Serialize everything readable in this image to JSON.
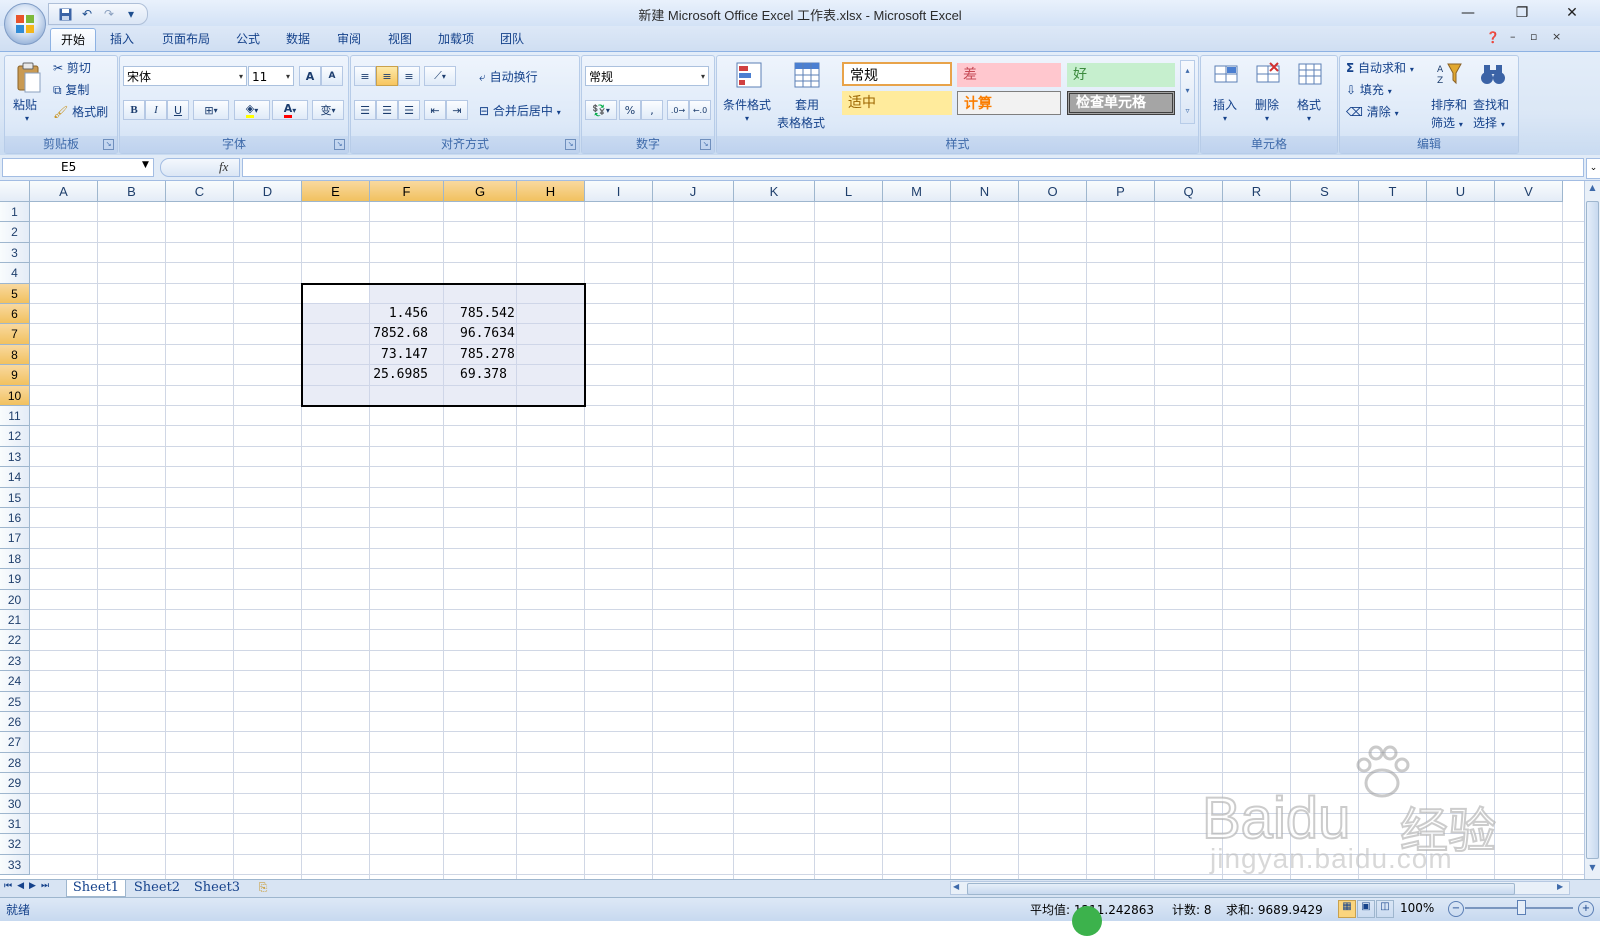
{
  "window": {
    "title": "新建 Microsoft Office Excel 工作表.xlsx - Microsoft Excel",
    "minimize": "—",
    "restore": "❐",
    "close": "✕"
  },
  "qat": {
    "save": "save-icon",
    "undo": "↶",
    "redo": "↷",
    "more": "▾"
  },
  "tabs": [
    "开始",
    "插入",
    "页面布局",
    "公式",
    "数据",
    "审阅",
    "视图",
    "加载项",
    "团队"
  ],
  "ribbon": {
    "clipboard": {
      "label": "剪贴板",
      "paste": "粘贴",
      "cut": "剪切",
      "copy": "复制",
      "format_painter": "格式刷"
    },
    "font": {
      "label": "字体",
      "name": "宋体",
      "size": "11",
      "bold": "B",
      "italic": "I",
      "underline": "U",
      "grow": "A",
      "shrink": "A",
      "phonetic": "变"
    },
    "alignment": {
      "label": "对齐方式",
      "wrap": "自动换行",
      "merge": "合并后居中"
    },
    "number": {
      "label": "数字",
      "format": "常规",
      "percent": "%",
      "comma": ","
    },
    "styles": {
      "label": "样式",
      "conditional": "条件格式",
      "table1": "套用",
      "table2": "表格格式",
      "normal": "常规",
      "bad": "差",
      "good": "好",
      "neutral": "适中",
      "calc": "计算",
      "check": "检查单元格"
    },
    "cells": {
      "label": "单元格",
      "insert": "插入",
      "delete": "删除",
      "format": "格式"
    },
    "editing": {
      "label": "编辑",
      "autosum": "自动求和",
      "fill": "填充",
      "clear": "清除",
      "sort1": "排序和",
      "sort2": "筛选",
      "find1": "查找和",
      "find2": "选择"
    }
  },
  "formula_bar": {
    "name_box": "E5",
    "fx": "fx",
    "formula": ""
  },
  "columns": [
    "A",
    "B",
    "C",
    "D",
    "E",
    "F",
    "G",
    "H",
    "I",
    "J",
    "K",
    "L",
    "M",
    "N",
    "O",
    "P",
    "Q",
    "R",
    "S",
    "T",
    "U",
    "V"
  ],
  "rows": [
    "1",
    "2",
    "3",
    "4",
    "5",
    "6",
    "7",
    "8",
    "9",
    "10",
    "11",
    "12",
    "13",
    "14",
    "15",
    "16",
    "17",
    "18",
    "19",
    "20",
    "21",
    "22",
    "23",
    "24",
    "25",
    "26",
    "27",
    "28",
    "29",
    "30",
    "31",
    "32",
    "33"
  ],
  "cells": {
    "F6": "1.456",
    "G6": "785.542",
    "F7": "7852.68",
    "G7": "96.7634",
    "F8": "73.147",
    "G8": "785.278",
    "F9": "25.6985",
    "G9": "69.378"
  },
  "sheets": [
    "Sheet1",
    "Sheet2",
    "Sheet3"
  ],
  "status": {
    "ready": "就绪",
    "average": "平均值: 1211.242863",
    "count": "计数: 8",
    "sum": "求和: 9689.9429",
    "zoom": "100%"
  },
  "watermark": {
    "brand": "Baidu",
    "cn": "经验",
    "url": "jingyan.baidu.com"
  }
}
